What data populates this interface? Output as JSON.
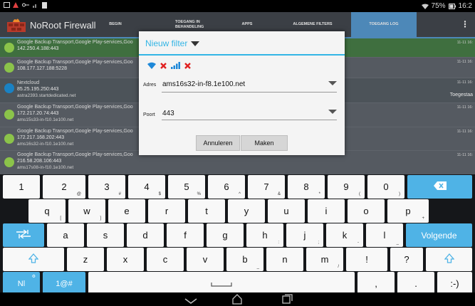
{
  "status_bar": {
    "battery_percent": "75%",
    "time": "16:2"
  },
  "app_bar": {
    "title": "NoRoot Firewall",
    "tabs": [
      {
        "label": "BEGIN",
        "active": false
      },
      {
        "label": "TOEGANG IN BEHANDELING",
        "active": false
      },
      {
        "label": "APPS",
        "active": false
      },
      {
        "label": "ALGEMENE FILTERS",
        "active": false
      },
      {
        "label": "TOEGANG LOG",
        "active": true
      }
    ]
  },
  "log_rows": [
    {
      "app": "Google Backup Transport,Google Play-services,Goo",
      "addr": "142.250.4.188:443",
      "host": "",
      "time": "11-11 16:",
      "extra": "",
      "style": "green"
    },
    {
      "app": "Google Backup Transport,Google Play-services,Goo",
      "addr": "108.177.127.188:5228",
      "host": "",
      "time": "11-11 16:",
      "extra": "",
      "style": "dark"
    },
    {
      "app": "Nextcloud",
      "addr": "85.25.195.250:443",
      "host": "astra2393.startdedicated.net",
      "time": "11-11 16:",
      "extra": "Toegestaa",
      "style": "dark"
    },
    {
      "app": "Google Backup Transport,Google Play-services,Goo",
      "addr": "172.217.20.74:443",
      "host": "ams15s33-in-f10.1e100.net",
      "time": "11-11 16:",
      "extra": "",
      "style": "dark"
    },
    {
      "app": "Google Backup Transport,Google Play-services,Goo",
      "addr": "172.217.168.202:443",
      "host": "ams16s32-in-f10.1e100.net",
      "time": "11-11 16:",
      "extra": "",
      "style": "dark"
    },
    {
      "app": "Google Backup Transport,Google Play-services,Goo",
      "addr": "216.58.208.106:443",
      "host": "ams17s08-in-f10.1e100.net",
      "time": "11-11 16:",
      "extra": "",
      "style": "dark"
    }
  ],
  "dialog": {
    "title": "Nieuw filter",
    "address_label": "Adres",
    "address_value": "ams16s32-in-f8.1e100.net",
    "port_label": "Poort",
    "port_value": "443",
    "cancel_label": "Annuleren",
    "create_label": "Maken"
  },
  "keyboard": {
    "row1": [
      {
        "main": "1",
        "sub": ""
      },
      {
        "main": "2",
        "sub": "@"
      },
      {
        "main": "3",
        "sub": "#"
      },
      {
        "main": "4",
        "sub": "$"
      },
      {
        "main": "5",
        "sub": "%"
      },
      {
        "main": "6",
        "sub": "^"
      },
      {
        "main": "7",
        "sub": "&"
      },
      {
        "main": "8",
        "sub": "*"
      },
      {
        "main": "9",
        "sub": "("
      },
      {
        "main": "0",
        "sub": ")"
      }
    ],
    "row2": [
      {
        "main": "q",
        "sub": "["
      },
      {
        "main": "w",
        "sub": "]"
      },
      {
        "main": "e",
        "sub": ""
      },
      {
        "main": "r",
        "sub": ""
      },
      {
        "main": "t",
        "sub": ""
      },
      {
        "main": "y",
        "sub": ""
      },
      {
        "main": "u",
        "sub": ""
      },
      {
        "main": "i",
        "sub": ""
      },
      {
        "main": "o",
        "sub": ""
      },
      {
        "main": "p",
        "sub": "+"
      }
    ],
    "row3": [
      {
        "main": "a",
        "sub": ""
      },
      {
        "main": "s",
        "sub": ""
      },
      {
        "main": "d",
        "sub": ""
      },
      {
        "main": "f",
        "sub": ""
      },
      {
        "main": "g",
        "sub": ""
      },
      {
        "main": "h",
        "sub": ":"
      },
      {
        "main": "j",
        "sub": ";"
      },
      {
        "main": "k",
        "sub": "-"
      },
      {
        "main": "l",
        "sub": "_"
      }
    ],
    "row4": [
      {
        "main": "z",
        "sub": ""
      },
      {
        "main": "x",
        "sub": ""
      },
      {
        "main": "c",
        "sub": ""
      },
      {
        "main": "v",
        "sub": ""
      },
      {
        "main": "b",
        "sub": "_"
      },
      {
        "main": "n",
        "sub": ""
      },
      {
        "main": "m",
        "sub": "/"
      },
      {
        "main": "!",
        "sub": ""
      },
      {
        "main": "?",
        "sub": ""
      }
    ],
    "enter_label": "Volgende",
    "lang_label": "Nl",
    "symbols_label": "1@#",
    "comma": ",",
    "period": ".",
    "smiley": ":-)",
    "accent_color": "#4fb3e6"
  }
}
